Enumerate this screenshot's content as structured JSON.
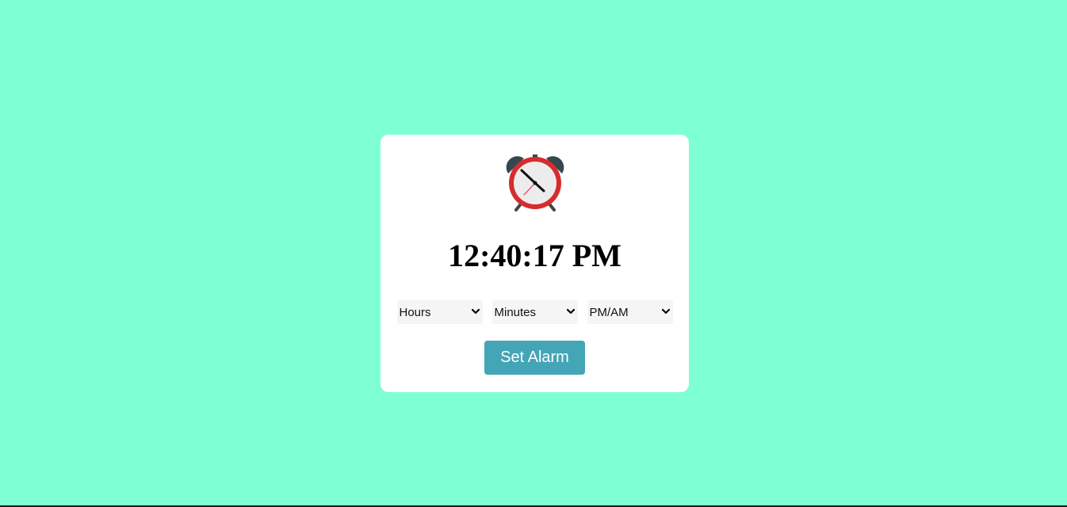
{
  "colors": {
    "page_background": "#7fffd4",
    "card_background": "#ffffff",
    "button_background": "#44a5b7",
    "button_text": "#ffffff",
    "clock_ring": "#d62c2c",
    "clock_bells": "#37474f"
  },
  "clock": {
    "icon": "alarm-clock-icon",
    "time": "12:40:17 PM"
  },
  "alarm_form": {
    "hours_select": {
      "selected": "Hours",
      "icon": "chevron-down-icon"
    },
    "minutes_select": {
      "selected": "Minutes",
      "icon": "chevron-down-icon"
    },
    "ampm_select": {
      "selected": "PM/AM",
      "icon": "chevron-down-icon"
    },
    "set_button_label": "Set Alarm"
  }
}
